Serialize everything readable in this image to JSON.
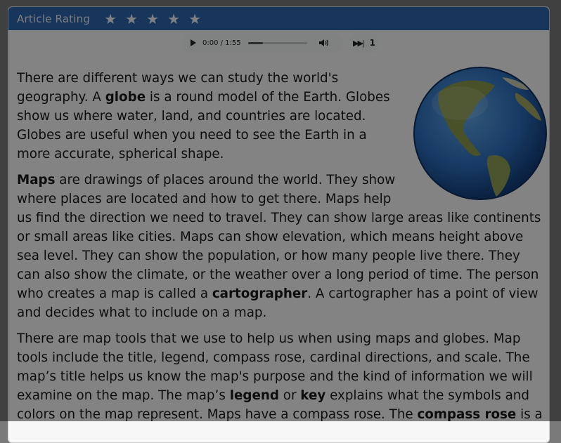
{
  "rating": {
    "label": "Article Rating",
    "stars": [
      "★",
      "★",
      "★",
      "★",
      "★"
    ]
  },
  "audio": {
    "time": "0:00 / 1:55",
    "progress_fraction": 0.25,
    "speed_value": "1"
  },
  "icons": {
    "play": "play-icon",
    "volume": "volume-icon",
    "speed": "fast-forward-icon",
    "globe": "globe-image"
  },
  "article": {
    "p1_pre": "There are different ways we can study the world's geography. A ",
    "p1_term": "globe",
    "p1_post": " is a round model of the Earth. Globes show us where water, land, and countries are located. Globes are useful when you need to see the Earth in a more accurate, spherical shape.",
    "p2_term": "Maps",
    "p2_mid": " are drawings of places around the world. They show where places are located and how to get there. Maps help us find the direction we need to travel. They can show large areas like continents or small areas like cities. Maps can show elevation, which means height above sea level. They can show the population, or how many people live there. They can also show the climate, or the weather over a long period of time. The person who creates a map is called a ",
    "p2_term2": "cartographer",
    "p2_post": ". A cartographer has a point of view and decides what to include on a map.",
    "p3_pre": "There are map tools that we use to help us when using maps and globes. Map tools include the title, legend, compass rose, cardinal directions, and scale. The map’s title helps us know the map's purpose and the kind of information we will examine on the map. The map’s ",
    "p3_term1": "legend",
    "p3_mid1": " or ",
    "p3_term2": "key",
    "p3_mid2": " explains what the symbols and colors on the map represent. Maps have a compass rose. The ",
    "p3_term3": "compass rose",
    "p3_post": " is a"
  },
  "colors": {
    "header": "#2f67ad",
    "overlay": "rgba(0,0,0,0.47)"
  }
}
